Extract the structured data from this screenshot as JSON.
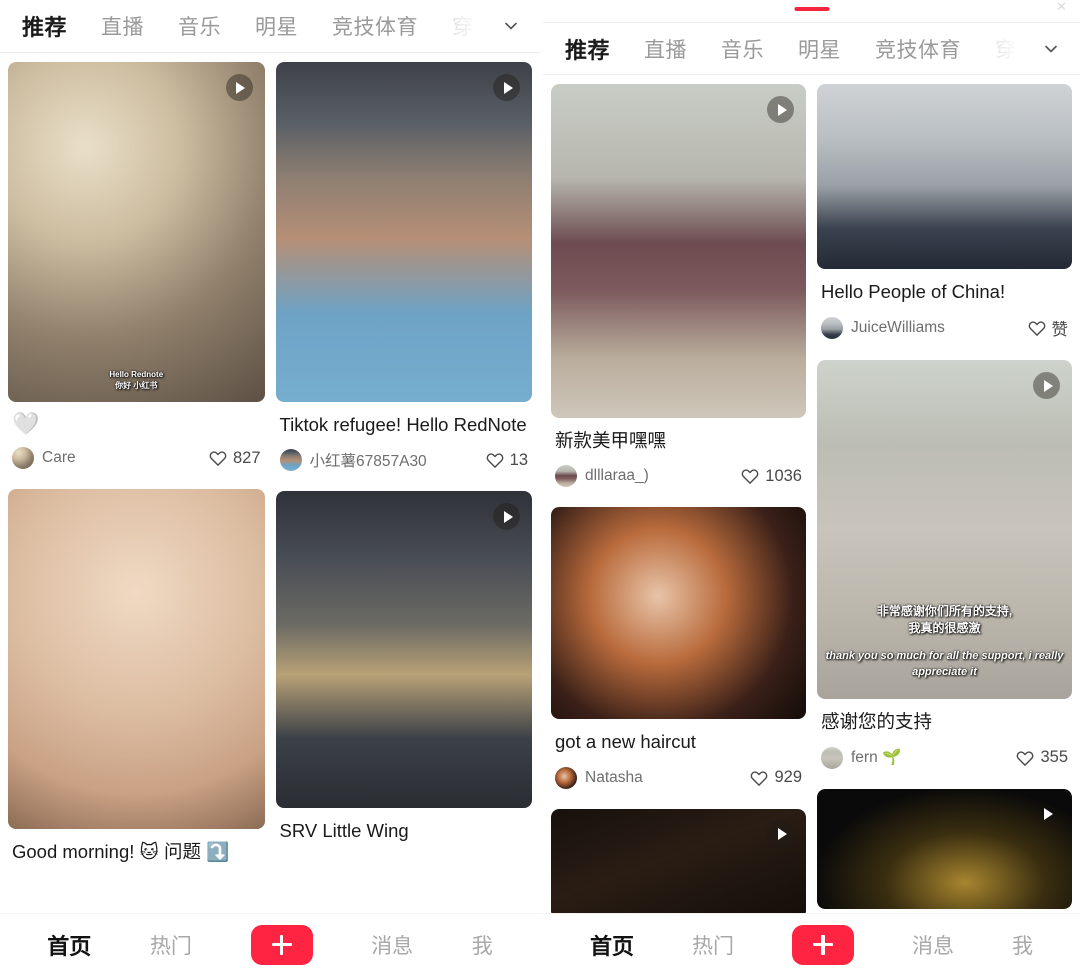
{
  "app": {
    "brand_color": "#ff2442",
    "accent_red": "#f4263e"
  },
  "panels": [
    {
      "id": "left",
      "tabs": [
        {
          "label": "推荐",
          "active": true
        },
        {
          "label": "直播",
          "active": false
        },
        {
          "label": "音乐",
          "active": false
        },
        {
          "label": "明星",
          "active": false
        },
        {
          "label": "竞技体育",
          "active": false
        },
        {
          "label": "穿",
          "active": false,
          "faded": true
        }
      ],
      "chevron_icon": "chevron-down-icon",
      "columns": [
        {
          "cards": [
            {
              "title": "🤍",
              "title_is_emoji": true,
              "author": "Care",
              "likes": "827",
              "has_play": true,
              "thumb_h": 340,
              "thumb_style": "warm-blur",
              "overlay": {
                "line1": "Hello Rednote",
                "line2": "你好 小红书"
              }
            },
            {
              "title": "Good morning! 🐱 问题 ⤵️",
              "title_is_emoji": false,
              "author": "",
              "likes": "",
              "has_play": false,
              "thumb_h": 340,
              "thumb_style": "portrait-warm",
              "overlay": null
            }
          ]
        },
        {
          "cards": [
            {
              "title": "Tiktok refugee! Hello RedNote",
              "title_is_emoji": false,
              "author": "小红薯67857A30",
              "likes": "13",
              "has_play": true,
              "thumb_h": 340,
              "thumb_style": "hat-man",
              "overlay": null
            },
            {
              "title": "SRV Little Wing",
              "title_is_emoji": false,
              "author": "",
              "likes": "",
              "has_play": true,
              "thumb_h": 317,
              "thumb_style": "guitar",
              "overlay": null
            }
          ]
        }
      ],
      "bottom_nav": [
        {
          "label": "首页",
          "active": true
        },
        {
          "label": "热门",
          "active": false
        },
        {
          "label": "plus",
          "is_plus": true
        },
        {
          "label": "消息",
          "active": false
        },
        {
          "label": "我",
          "active": false
        }
      ]
    },
    {
      "id": "right",
      "tabs": [
        {
          "label": "推荐",
          "active": true
        },
        {
          "label": "直播",
          "active": false
        },
        {
          "label": "音乐",
          "active": false
        },
        {
          "label": "明星",
          "active": false
        },
        {
          "label": "竞技体育",
          "active": false
        },
        {
          "label": "穿",
          "active": false,
          "faded": true
        }
      ],
      "chevron_icon": "chevron-down-icon",
      "columns": [
        {
          "cards": [
            {
              "title": "新款美甲嘿嘿",
              "title_is_emoji": false,
              "author": "dlllaraa_)",
              "likes": "1036",
              "has_play": true,
              "thumb_h": 334,
              "thumb_style": "window-girl",
              "overlay": null
            },
            {
              "title": "got a new haircut",
              "title_is_emoji": false,
              "author": "Natasha",
              "likes": "929",
              "has_play": false,
              "thumb_h": 212,
              "thumb_style": "red-hair",
              "overlay": null
            },
            {
              "title": "",
              "title_is_emoji": false,
              "author": "",
              "likes": "",
              "has_play": true,
              "thumb_h": 110,
              "thumb_style": "dark-room",
              "overlay": null
            }
          ]
        },
        {
          "cards": [
            {
              "title": "Hello People of China!",
              "title_is_emoji": false,
              "author": "JuiceWilliams",
              "likes": "赞",
              "has_play": false,
              "thumb_h": 185,
              "thumb_style": "suit-man",
              "overlay": null
            },
            {
              "title": "感谢您的支持",
              "title_is_emoji": false,
              "author": "fern 🌱",
              "likes": "355",
              "has_play": true,
              "thumb_h": 339,
              "thumb_style": "thankyou-room",
              "overlay": {
                "cn": "非常感谢你们所有的支持,\n我真的很感激",
                "en": "thank you so much for all the support, i really appreciate it"
              }
            },
            {
              "title": "",
              "title_is_emoji": false,
              "author": "",
              "likes": "",
              "has_play": true,
              "thumb_h": 120,
              "thumb_style": "cymbal",
              "overlay": null
            }
          ]
        }
      ],
      "bottom_nav": [
        {
          "label": "首页",
          "active": true
        },
        {
          "label": "热门",
          "active": false
        },
        {
          "label": "plus",
          "is_plus": true
        },
        {
          "label": "消息",
          "active": false
        },
        {
          "label": "我",
          "active": false
        }
      ]
    }
  ]
}
